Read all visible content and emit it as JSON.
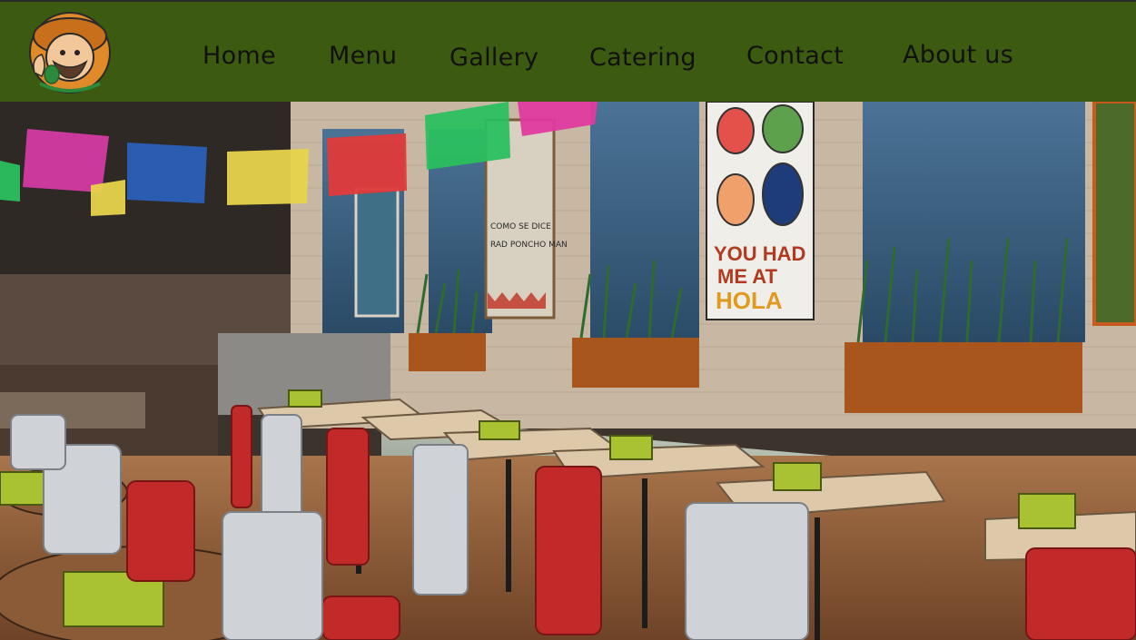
{
  "header": {
    "logo": {
      "icon": "mascot-logo-icon"
    },
    "nav": [
      {
        "label": "Home"
      },
      {
        "label": "Menu"
      },
      {
        "label": "Gallery"
      },
      {
        "label": "Catering"
      },
      {
        "label": "Contact"
      },
      {
        "label": "About us"
      }
    ]
  },
  "hero": {
    "poster_main": {
      "line1": "YOU HAD",
      "line2": "ME AT",
      "line3": "HOLA"
    },
    "poster_left": {
      "text1": "COMO SE DICE",
      "text2": "RAD PONCHO MAN"
    },
    "colors": {
      "nav_bg": "#3d5a11",
      "poster_red": "#b23a21",
      "wall": "#c7b7a3",
      "window": "#3b5f7e",
      "wood": "#8b5a36",
      "red_chair": "#c22a2a",
      "planter": "#a8551e"
    }
  }
}
